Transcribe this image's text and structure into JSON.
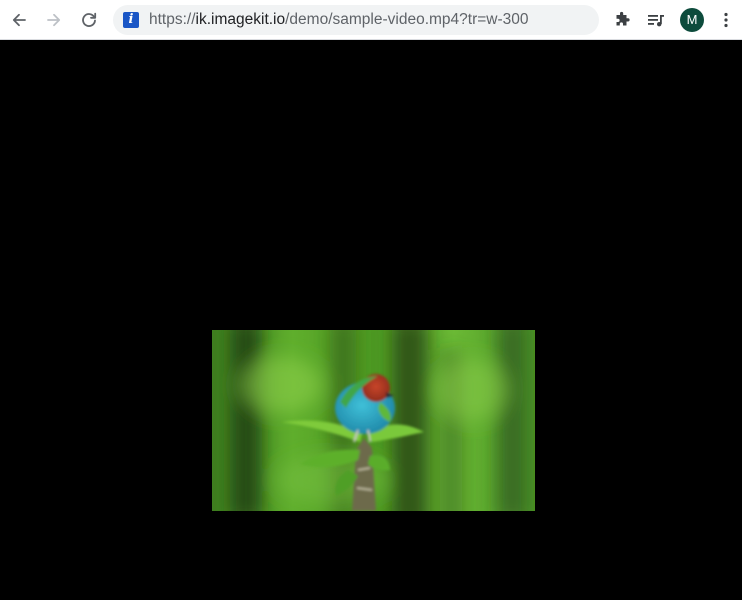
{
  "browser": {
    "url": {
      "scheme": "https://",
      "host": "ik.imagekit.io",
      "path": "/demo/sample-video.mp4?tr=w-300"
    },
    "avatar_letter": "M",
    "icons": {
      "back": "arrow-left-icon",
      "forward": "arrow-right-icon",
      "reload": "reload-icon",
      "site_info": "info-icon",
      "extensions": "puzzle-icon",
      "media": "media-queue-icon",
      "menu": "kebab-menu-icon"
    },
    "colors": {
      "toolbar_bg": "#ffffff",
      "omnibox_bg": "#f1f3f4",
      "info_badge": "#1a56c6",
      "avatar_bg": "#0d4b3c"
    }
  },
  "content": {
    "background": "#000000",
    "video": {
      "subject": "bird-on-branch"
    }
  }
}
